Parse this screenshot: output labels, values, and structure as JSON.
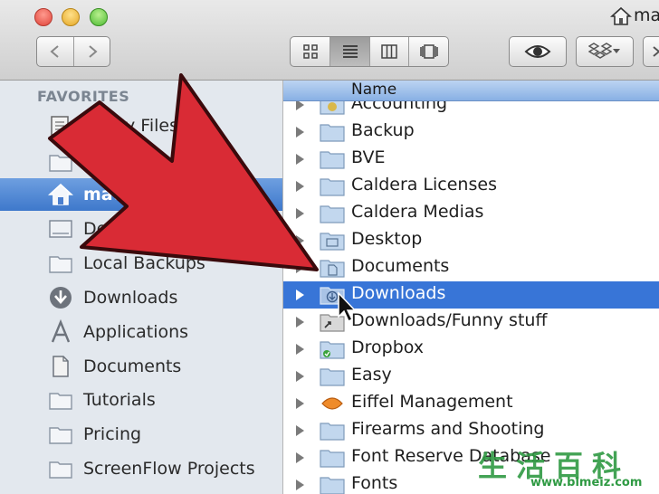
{
  "window": {
    "title": "mati"
  },
  "toolbar": {
    "back_icon": "chevron-left-icon",
    "forward_icon": "chevron-right-icon",
    "view_modes": [
      "icon-view",
      "list-view",
      "column-view",
      "coverflow-view"
    ],
    "active_view": "list-view",
    "quicklook_icon": "eye-icon",
    "dropbox_icon": "dropbox-icon"
  },
  "sidebar": {
    "header": "FAVORITES",
    "items": [
      {
        "label": "All My Files",
        "icon": "all-files-icon"
      },
      {
        "label": "",
        "icon": "folder-icon"
      },
      {
        "label": "matias",
        "icon": "home-icon",
        "selected": true
      },
      {
        "label": "Desktop",
        "icon": "desktop-icon"
      },
      {
        "label": "Local Backups",
        "icon": "folder-icon"
      },
      {
        "label": "Downloads",
        "icon": "downloads-icon"
      },
      {
        "label": "Applications",
        "icon": "applications-icon"
      },
      {
        "label": "Documents",
        "icon": "documents-icon"
      },
      {
        "label": "Tutorials",
        "icon": "folder-icon"
      },
      {
        "label": "Pricing",
        "icon": "folder-icon"
      },
      {
        "label": "ScreenFlow Projects",
        "icon": "folder-icon"
      }
    ]
  },
  "main": {
    "column_header": "Name",
    "rows": [
      {
        "label": "Accounting",
        "icon": "accounting-folder-icon"
      },
      {
        "label": "Backup",
        "icon": "folder-icon"
      },
      {
        "label": "BVE",
        "icon": "folder-icon"
      },
      {
        "label": "Caldera Licenses",
        "icon": "folder-icon"
      },
      {
        "label": "Caldera Medias",
        "icon": "folder-icon"
      },
      {
        "label": "Desktop",
        "icon": "desktop-folder-icon"
      },
      {
        "label": "Documents",
        "icon": "documents-folder-icon"
      },
      {
        "label": "Downloads",
        "icon": "downloads-folder-icon",
        "selected": true
      },
      {
        "label": "Downloads/Funny stuff",
        "icon": "alias-folder-icon"
      },
      {
        "label": "Dropbox",
        "icon": "dropbox-folder-icon"
      },
      {
        "label": "Easy",
        "icon": "folder-icon"
      },
      {
        "label": "Eiffel Management",
        "icon": "eiffel-icon"
      },
      {
        "label": "Firearms and Shooting",
        "icon": "folder-icon"
      },
      {
        "label": "Font Reserve Database",
        "icon": "folder-icon"
      },
      {
        "label": "Fonts",
        "icon": "folder-icon"
      }
    ]
  },
  "overlay": {
    "arrow_color": "#d92b35",
    "arrow_icon": "red-arrow-icon"
  },
  "watermark": {
    "text_cn": "生活百科",
    "url": "www.bimeiz.com"
  },
  "colors": {
    "selection": "#3875d7",
    "sidebar_bg": "#e3e8ee",
    "sidebar_selected": "#4a82d2"
  }
}
